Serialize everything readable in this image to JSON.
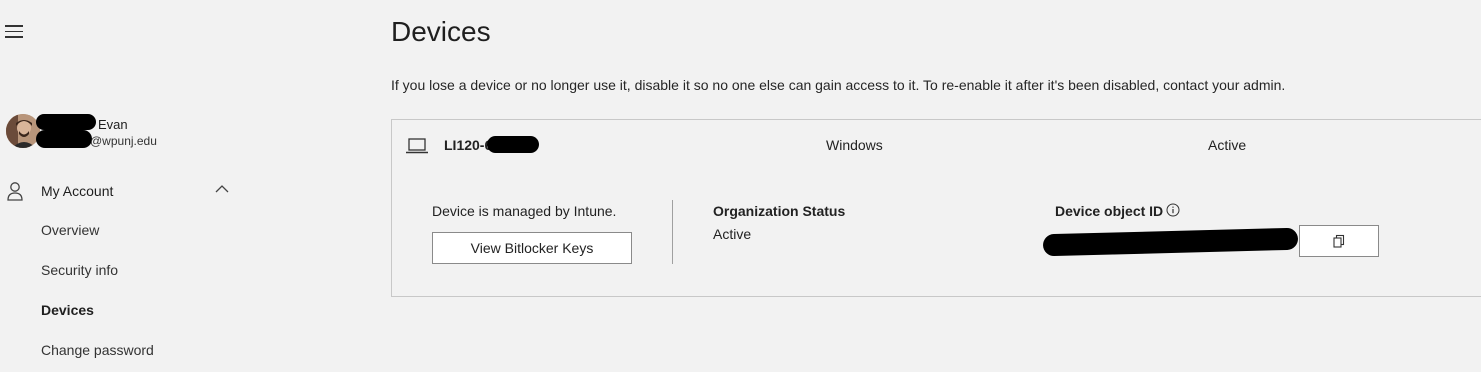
{
  "sidebar": {
    "user": {
      "name": "Evan",
      "email": "@wpunj.edu"
    },
    "account_label": "My Account",
    "items": [
      {
        "label": "Overview",
        "active": false
      },
      {
        "label": "Security info",
        "active": false
      },
      {
        "label": "Devices",
        "active": true
      },
      {
        "label": "Change password",
        "active": false
      }
    ]
  },
  "main": {
    "title": "Devices",
    "description": "If you lose a device or no longer use it, disable it so no one else can gain access to it. To re-enable it after it's been disabled, contact your admin.",
    "device": {
      "name": "LI120-6          4",
      "os": "Windows",
      "status": "Active",
      "managed_text": "Device is managed by Intune.",
      "bitlocker_button": "View Bitlocker Keys",
      "org_status_label": "Organization Status",
      "org_status_value": "Active",
      "object_id_label": "Device object ID"
    }
  },
  "icons": {
    "menu": "hamburger-menu-icon",
    "account": "person-icon",
    "collapse": "chevron-up-icon",
    "device": "laptop-icon",
    "info": "info-icon",
    "copy": "copy-icon"
  }
}
